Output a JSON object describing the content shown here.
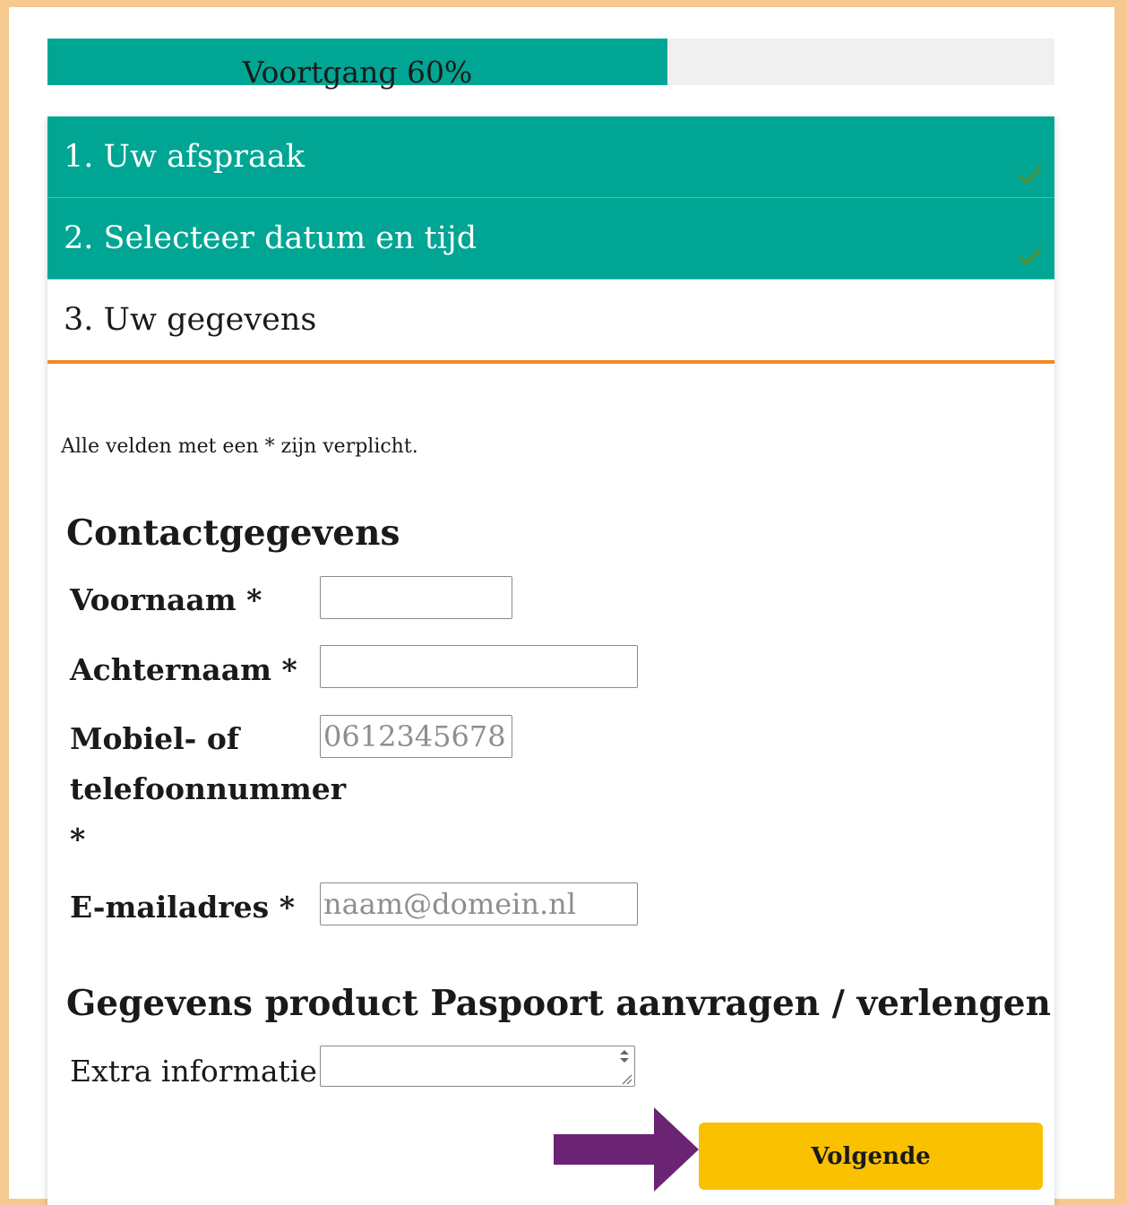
{
  "progress": {
    "label": "Voortgang 60%",
    "percent": 60,
    "fill_color": "#00a693"
  },
  "steps": [
    {
      "label": "1. Uw afspraak",
      "state": "done",
      "icon": "check-icon"
    },
    {
      "label": "2. Selecteer datum en tijd",
      "state": "done",
      "icon": "check-icon"
    },
    {
      "label": "3. Uw gegevens",
      "state": "current"
    }
  ],
  "form": {
    "required_note": "Alle velden met een * zijn verplicht.",
    "contact_heading": "Contactgegevens",
    "fields": {
      "first_name": {
        "label": "Voornaam *",
        "value": "",
        "placeholder": ""
      },
      "last_name": {
        "label": "Achternaam *",
        "value": "",
        "placeholder": ""
      },
      "phone": {
        "label_line1": "Mobiel- of",
        "label_line2": "telefoonnummer",
        "label_line3": "*",
        "value": "",
        "placeholder": "0612345678"
      },
      "email": {
        "label": "E-mailadres *",
        "value": "",
        "placeholder": "naam@domein.nl"
      }
    },
    "product_heading": "Gegevens product Paspoort aanvragen / verlengen",
    "extra_info": {
      "label": "Extra informatie",
      "value": ""
    }
  },
  "buttons": {
    "next": "Volgende"
  },
  "colors": {
    "accent": "#00a693",
    "active_border": "#f08a24",
    "button": "#f9c100",
    "annotation_arrow": "#6b2474",
    "frame": "#f5c98f"
  }
}
